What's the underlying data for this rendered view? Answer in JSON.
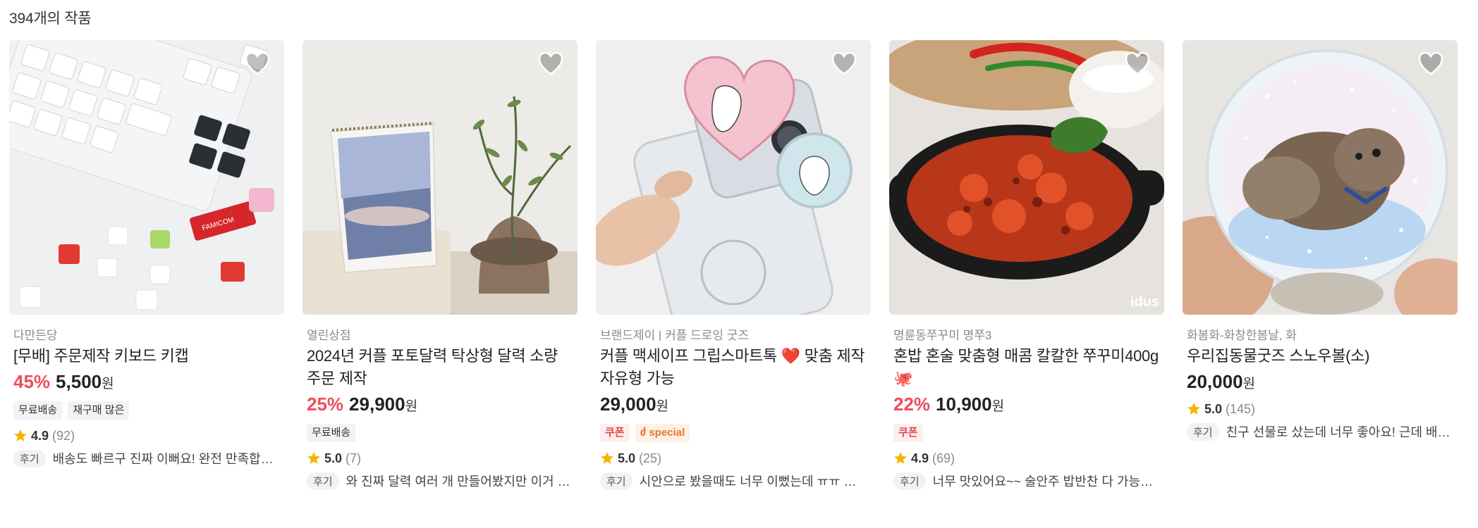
{
  "result_count": "394개의 작품",
  "colors": {
    "discount": "#ef4c5a",
    "star": "#f5b400",
    "coupon": "#e5484d",
    "special": "#e9772c"
  },
  "heart_icon": "heart-outline-icon",
  "star_icon": "star-filled-icon",
  "review_badge": "후기",
  "won": "원",
  "products": [
    {
      "shop": "다만든당",
      "title": "[무배] 주문제작 키보드 키캡",
      "discount": "45%",
      "price": "5,500",
      "tags": [
        "무료배송",
        "재구매 많은"
      ],
      "rating": "4.9",
      "review_count": "(92)",
      "review": "배송도 빠르구 진짜 이뻐요! 완전 만족합니다 감사합니다"
    },
    {
      "shop": "열린상점",
      "title": "2024년 커플 포토달력 탁상형 달력 소량 주문 제작",
      "discount": "25%",
      "price": "29,900",
      "tags": [
        "무료배송"
      ],
      "rating": "5.0",
      "review_count": "(7)",
      "review": "와 진짜 달력 여러 개 만들어봤지만 이거 최고예요"
    },
    {
      "shop": "브랜드제이 | 커플 드로잉 굿즈",
      "title": "커플 맥세이프 그립스마트톡 ❤️ 맞춤 제작 자유형 가능",
      "discount": "",
      "price": "29,000",
      "tags": [
        "쿠폰",
        "special"
      ],
      "rating": "5.0",
      "review_count": "(25)",
      "review": "시안으로 봤을때도 너무 이뻤는데 ㅠㅠ 실물이 훨씬 예뻐요"
    },
    {
      "shop": "명륜동쭈꾸미 명쭈3",
      "title": "혼밥 혼술 맞춤형 매콤 칼칼한 쭈꾸미400g 🐙",
      "discount": "22%",
      "price": "10,900",
      "tags": [
        "쿠폰"
      ],
      "rating": "4.9",
      "review_count": "(69)",
      "review": "너무 맛있어요~~ 술안주 밥반찬 다 가능해요 또 주문할게요"
    },
    {
      "shop": "화봄화-화창한봄날, 화",
      "title": "우리집동물굿즈 스노우볼(소)",
      "discount": "",
      "price": "20,000",
      "tags": [],
      "rating": "5.0",
      "review_count": "(145)",
      "review": "친구 선물로 샀는데 너무 좋아요! 근데 배송이 조금 늦었어요"
    }
  ],
  "watermark": "idus"
}
